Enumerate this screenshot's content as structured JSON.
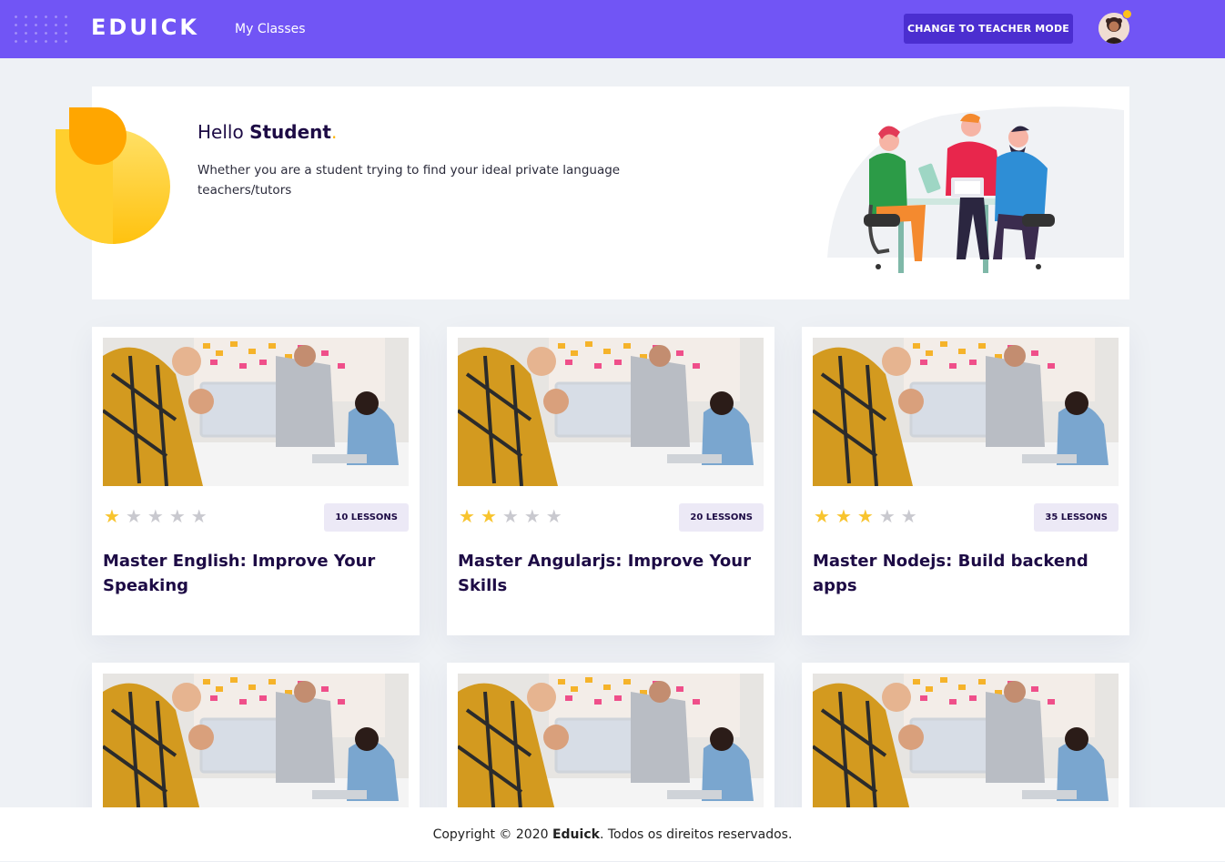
{
  "header": {
    "logo": "EDUICK",
    "nav_my_classes": "My Classes",
    "mode_button": "CHANGE TO TEACHER MODE"
  },
  "hero": {
    "greeting": "Hello",
    "name": "Student",
    "punct": ".",
    "description": "Whether you are a student trying to find your ideal private language teachers/tutors"
  },
  "courses": [
    {
      "title": "Master English: Improve Your Speaking",
      "lessons": "10 LESSONS",
      "rating": 1
    },
    {
      "title": "Master Angularjs: Improve Your Skills",
      "lessons": "20 LESSONS",
      "rating": 2
    },
    {
      "title": "Master Nodejs: Build backend apps",
      "lessons": "35 LESSONS",
      "rating": 3
    },
    {
      "title": "",
      "lessons": "",
      "rating": 0
    },
    {
      "title": "",
      "lessons": "",
      "rating": 0
    },
    {
      "title": "",
      "lessons": "",
      "rating": 0
    }
  ],
  "footer": {
    "prefix": "Copyright © 2020 ",
    "brand": "Eduick",
    "suffix": ". Todos os direitos reservados."
  },
  "colors": {
    "header_bg": "#7155f5",
    "button_bg": "#4b2ed0",
    "title_text": "#1d0b45",
    "star_on": "#f8c42e",
    "star_off": "#c9c9cf",
    "accent_yellow": "#ffc20f"
  }
}
